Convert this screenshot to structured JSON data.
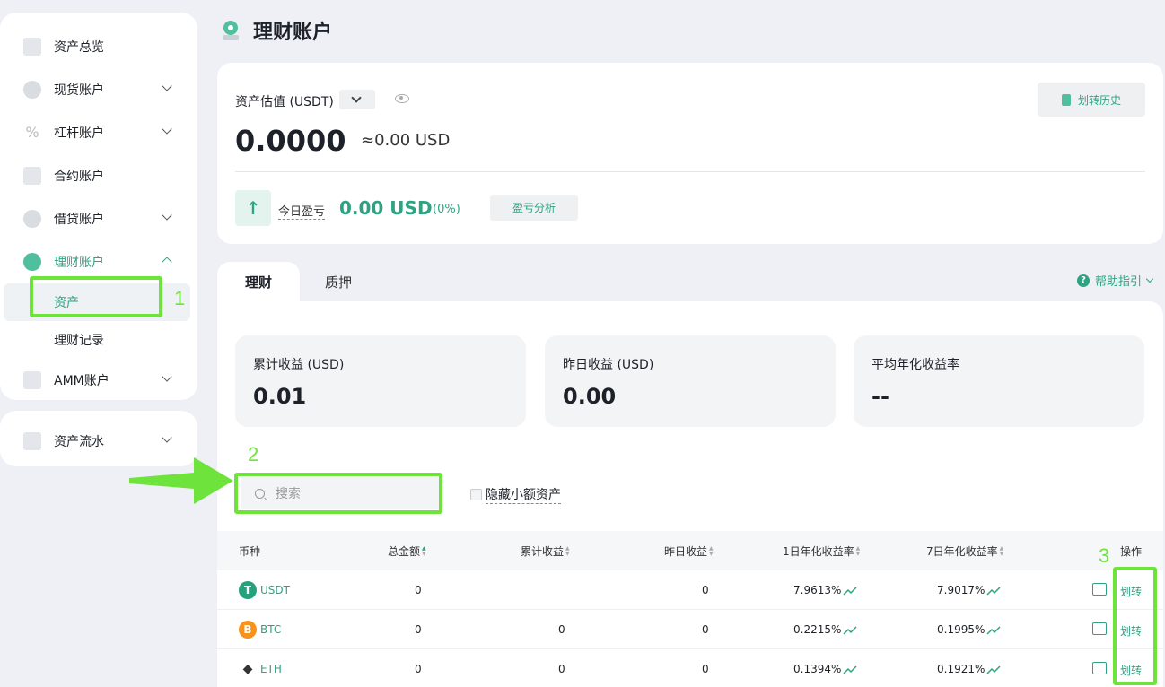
{
  "sidebar": {
    "items": [
      {
        "label": "资产总览"
      },
      {
        "label": "现货账户"
      },
      {
        "label": "杠杆账户"
      },
      {
        "label": "合约账户"
      },
      {
        "label": "借贷账户"
      },
      {
        "label": "理财账户"
      },
      {
        "label": "AMM账户"
      }
    ],
    "sub_items": [
      {
        "label": "资产"
      },
      {
        "label": "理财记录"
      }
    ],
    "flow": {
      "label": "资产流水"
    }
  },
  "header": {
    "title": "理财账户"
  },
  "summary": {
    "est_label": "资产估值 (USDT)",
    "value": "0.0000",
    "approx": "≈0.00 USD",
    "history_button": "划转历史",
    "today_label": "今日盈亏",
    "today_value": "0.00 USD",
    "today_pct": "(0%)",
    "pnl_button": "盈亏分析"
  },
  "tabs": [
    {
      "label": "理财"
    },
    {
      "label": "质押"
    }
  ],
  "help": {
    "label": "帮助指引"
  },
  "stats": [
    {
      "label": "累计收益 (USD)",
      "value": "0.01"
    },
    {
      "label": "昨日收益 (USD)",
      "value": "0.00"
    },
    {
      "label": "平均年化收益率",
      "value": "--"
    }
  ],
  "search": {
    "placeholder": "搜索"
  },
  "hide_small": {
    "label": "隐藏小额资产"
  },
  "table": {
    "headers": [
      "币种",
      "总金额",
      "累计收益",
      "昨日收益",
      "1日年化收益率",
      "7日年化收益率",
      "操作"
    ],
    "rows": [
      {
        "coin": "USDT",
        "total": "0",
        "cum": "",
        "yest": "0",
        "apr1": "7.9613%",
        "apr7": "7.9017%",
        "action": "划转"
      },
      {
        "coin": "BTC",
        "total": "0",
        "cum": "0",
        "yest": "0",
        "apr1": "0.2215%",
        "apr7": "0.1995%",
        "action": "划转"
      },
      {
        "coin": "ETH",
        "total": "0",
        "cum": "0",
        "yest": "0",
        "apr1": "0.1394%",
        "apr7": "0.1921%",
        "action": "划转"
      }
    ]
  },
  "annotations": {
    "n1": "1",
    "n2": "2",
    "n3": "3"
  },
  "colors": {
    "accent": "#2ea382",
    "highlight": "#6ee33b",
    "usdt": "#26a17b",
    "btc": "#f7931a"
  }
}
